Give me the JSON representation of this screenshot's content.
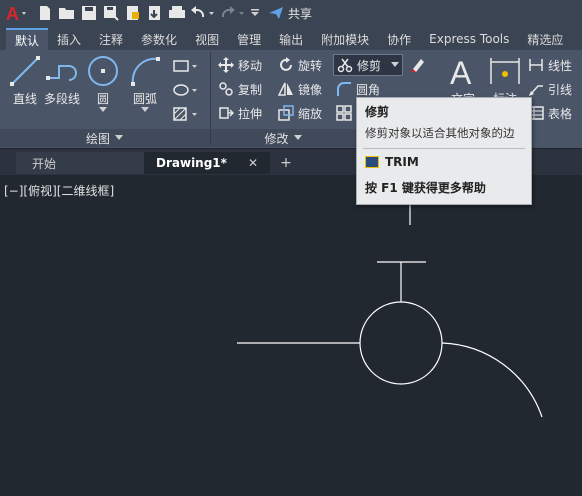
{
  "qa": {
    "share_label": "共享"
  },
  "tabs": [
    "默认",
    "插入",
    "注释",
    "参数化",
    "视图",
    "管理",
    "输出",
    "附加模块",
    "协作",
    "Express Tools",
    "精选应"
  ],
  "ribbon": {
    "draw_panel": {
      "title": "绘图",
      "tools": [
        "直线",
        "多段线",
        "圆",
        "圆弧"
      ]
    },
    "modify_panel": {
      "title": "修改",
      "tools": {
        "move": "移动",
        "rotate": "旋转",
        "trim": "修剪",
        "copy": "复制",
        "mirror": "镜像",
        "fillet": "圆角",
        "stretch": "拉伸",
        "scale": "缩放"
      }
    },
    "annotation_panel": {
      "text": "文字",
      "dim": "标注",
      "linear": "线性",
      "leader": "引线",
      "table": "表格"
    }
  },
  "doc_tabs": {
    "start": "开始",
    "drawing": "Drawing1*",
    "close": "✕",
    "add": "+"
  },
  "viewport_label": "[−][俯视][二维线框]",
  "tooltip": {
    "title": "修剪",
    "description": "修剪对象以适合其他对象的边",
    "command": "TRIM",
    "help": "按 F1 键获得更多帮助"
  },
  "colors": {
    "accent": "#5fa0e6",
    "background": "#212830",
    "ribbon": "#4a5568",
    "logo_red": "#d9262a"
  }
}
